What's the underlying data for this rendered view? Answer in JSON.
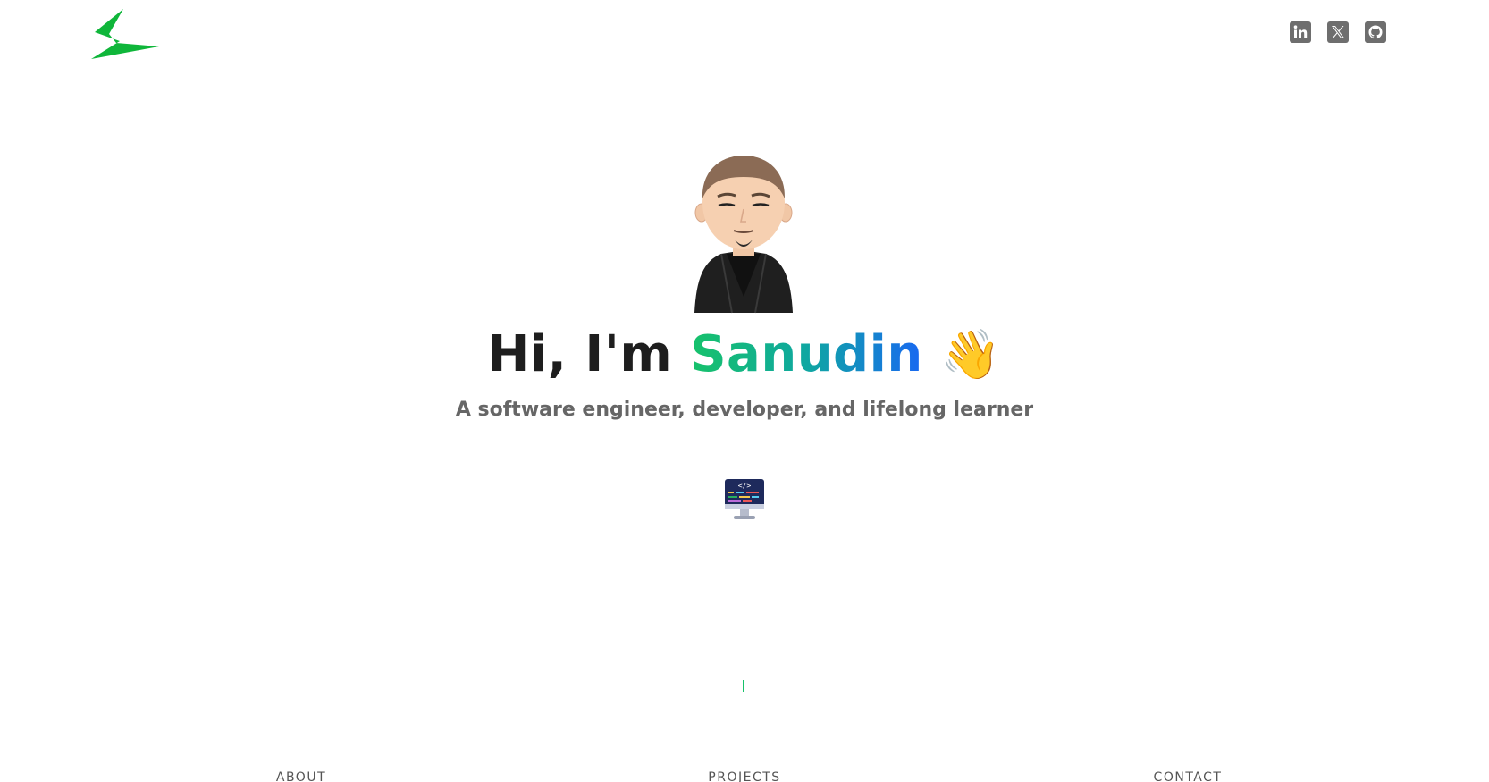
{
  "header": {
    "logo_icon": "lightning-bolt-logo",
    "accent_color": "#0fb63a",
    "socials": [
      {
        "name": "linkedin",
        "icon": "linkedin-icon"
      },
      {
        "name": "x",
        "icon": "x-icon"
      },
      {
        "name": "github",
        "icon": "github-icon"
      }
    ]
  },
  "hero": {
    "avatar_icon": "cartoon-avatar",
    "greeting": "Hi, I'm ",
    "name": "Sanudin",
    "wave": "👋",
    "tagline": "A software engineer, developer, and lifelong learner",
    "monitor_icon": "code-monitor-icon",
    "gradient": [
      "#17c26a",
      "#0fa7a1",
      "#1968f2"
    ]
  },
  "nav": {
    "items": [
      {
        "label": "ABOUT"
      },
      {
        "label": "PROJECTS"
      },
      {
        "label": "CONTACT"
      }
    ]
  }
}
